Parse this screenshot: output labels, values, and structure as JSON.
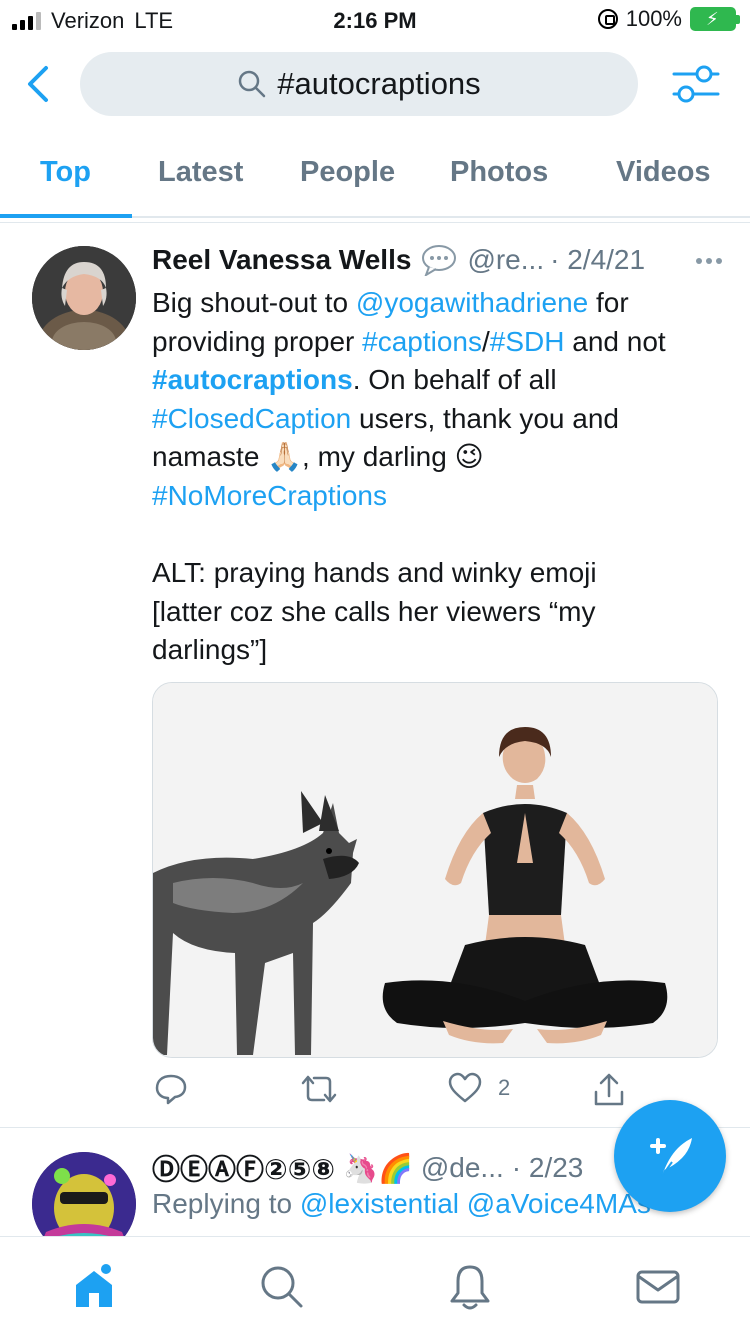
{
  "status_bar": {
    "carrier": "Verizon",
    "network": "LTE",
    "time": "2:16 PM",
    "battery_percent": "100%"
  },
  "search": {
    "query": "#autocraptions"
  },
  "tabs": [
    {
      "label": "Top",
      "active": true
    },
    {
      "label": "Latest",
      "active": false
    },
    {
      "label": "People",
      "active": false
    },
    {
      "label": "Photos",
      "active": false
    },
    {
      "label": "Videos",
      "active": false
    }
  ],
  "tweet": {
    "name": "Reel Vanessa Wells",
    "handle": "@re...",
    "date": "· 2/4/21",
    "body": {
      "p1": "Big shout-out to ",
      "mention": "@yogawithadriene",
      "p2": " for providing proper ",
      "tag_captions": "#captions",
      "slash": "/",
      "tag_sdh": "#SDH",
      "p3": " and not ",
      "tag_auto": "#autocraptions",
      "p4": ". On behalf of all ",
      "tag_cc": "#ClosedCaption",
      "p5": " users, thank you and namaste ",
      "emoji_pray": "🙏🏻",
      "p6": ", my darling ",
      "emoji_wink": "😉",
      "tag_nomore": "#NoMoreCraptions",
      "alt1": "ALT: praying hands and winky emoji",
      "alt2": "[latter coz she calls her viewers “my darlings”]"
    },
    "likes": "2"
  },
  "tweet2": {
    "name": "ⒹⒺⒶⒻ②⑤⑧",
    "emojis": "🦄🌈",
    "handle": "@de...",
    "date": "· 2/23",
    "replying_prefix": "Replying to ",
    "replying_mentions": "@lexistential @aVoice4MAs"
  },
  "colors": {
    "accent": "#1da1f2",
    "secondary_text": "#657786",
    "search_bg": "#e6ecf0"
  }
}
